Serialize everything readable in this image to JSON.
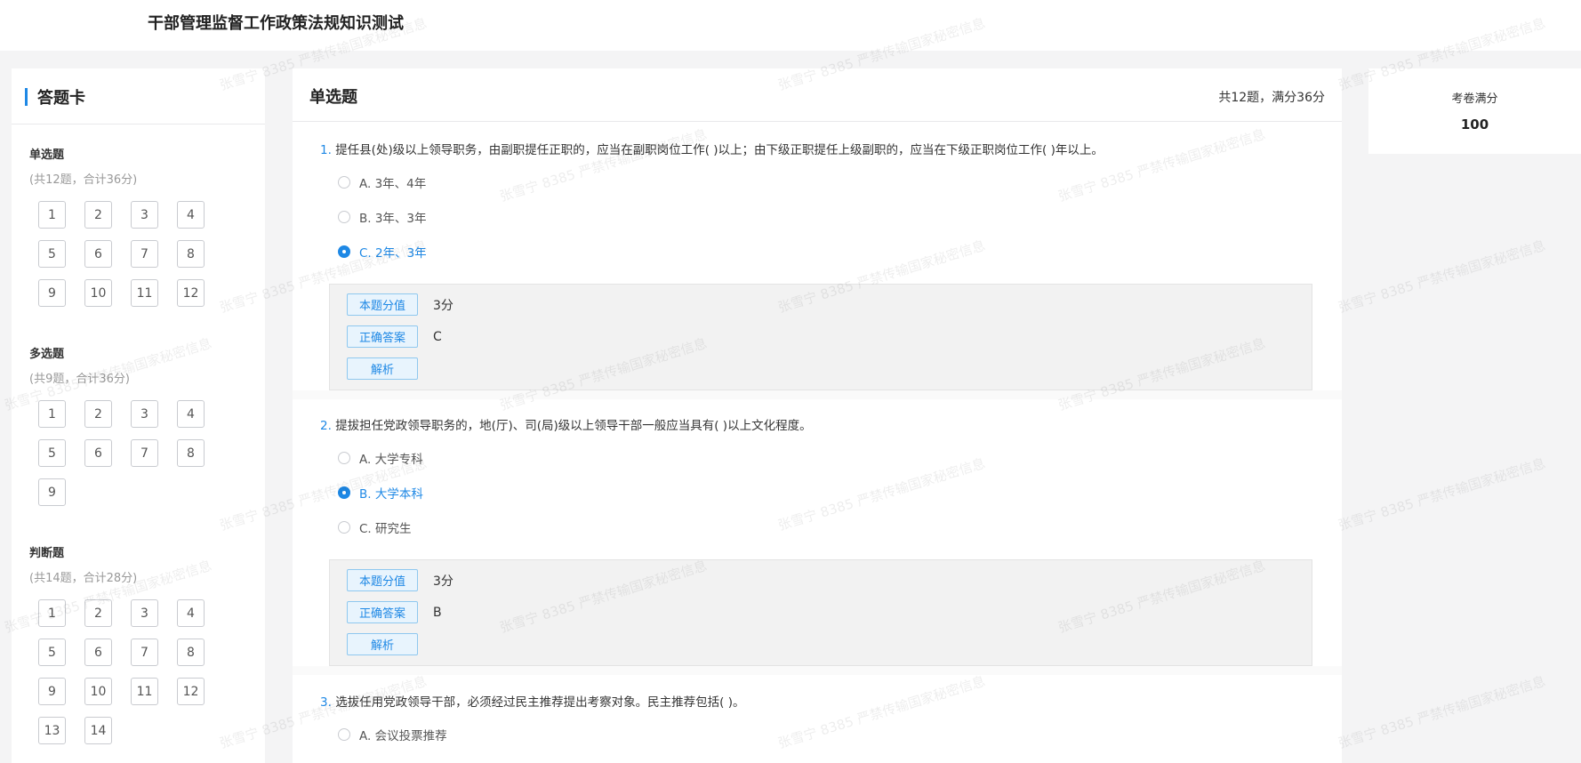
{
  "header": {
    "title": "干部管理监督工作政策法规知识测试"
  },
  "card": {
    "title": "答题卡",
    "sections": [
      {
        "name": "单选题",
        "summary": "(共12题，合计36分)",
        "numbers": [
          "1",
          "2",
          "3",
          "4",
          "5",
          "6",
          "7",
          "8",
          "9",
          "10",
          "11",
          "12"
        ]
      },
      {
        "name": "多选题",
        "summary": "(共9题，合计36分)",
        "numbers": [
          "1",
          "2",
          "3",
          "4",
          "5",
          "6",
          "7",
          "8",
          "9"
        ]
      },
      {
        "name": "判断题",
        "summary": "(共14题，合计28分)",
        "numbers": [
          "1",
          "2",
          "3",
          "4",
          "5",
          "6",
          "7",
          "8",
          "9",
          "10",
          "11",
          "12",
          "13",
          "14"
        ]
      }
    ]
  },
  "main": {
    "title": "单选题",
    "info": "共12题，满分36分",
    "questions": [
      {
        "num": "1.",
        "stem": "提任县(处)级以上领导职务，由副职提任正职的，应当在副职岗位工作( )以上；由下级正职提任上级副职的，应当在下级正职岗位工作( )年以上。",
        "options": [
          {
            "label": "A. 3年、4年",
            "selected": false
          },
          {
            "label": "B. 3年、3年",
            "selected": false
          },
          {
            "label": "C. 2年、3年",
            "selected": true
          }
        ],
        "score_tag": "本题分值",
        "score": "3分",
        "answer_tag": "正确答案",
        "answer": "C",
        "analysis_tag": "解析"
      },
      {
        "num": "2.",
        "stem": "提拔担任党政领导职务的，地(厅)、司(局)级以上领导干部一般应当具有( )以上文化程度。",
        "options": [
          {
            "label": "A. 大学专科",
            "selected": false
          },
          {
            "label": "B. 大学本科",
            "selected": true
          },
          {
            "label": "C. 研究生",
            "selected": false
          }
        ],
        "score_tag": "本题分值",
        "score": "3分",
        "answer_tag": "正确答案",
        "answer": "B",
        "analysis_tag": "解析"
      },
      {
        "num": "3.",
        "stem": "选拔任用党政领导干部，必须经过民主推荐提出考察对象。民主推荐包括( )。",
        "options": [
          {
            "label": "A. 会议投票推荐",
            "selected": false
          }
        ]
      }
    ]
  },
  "score_panel": {
    "label": "考卷满分",
    "value": "100"
  },
  "watermark": "张雪宁 8385 严禁传输国家秘密信息",
  "colors": {
    "accent": "#1e88e5",
    "background": "#f4f4f5"
  }
}
